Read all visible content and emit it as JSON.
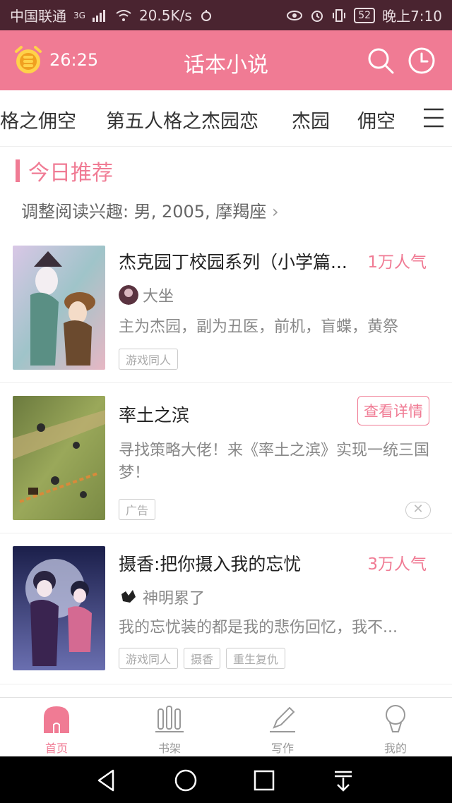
{
  "status_bar": {
    "carrier": "中国联通",
    "network": "3G",
    "speed": "20.5K/s",
    "battery": "52",
    "time": "晚上7:10"
  },
  "header": {
    "timer": "26:25",
    "title": "话本小说"
  },
  "tabs": [
    "格之佣空",
    "第五人格之杰园恋",
    "杰园",
    "佣空"
  ],
  "section": {
    "title": "今日推荐",
    "preference": "调整阅读兴趣: 男, 2005, 摩羯座"
  },
  "books": [
    {
      "title": "杰克园丁校园系列（小学篇...",
      "popularity": "1万人气",
      "author": "大坐",
      "description": "主为杰园，副为丑医，前机，盲蝶，黄祭",
      "tags": [
        "游戏同人"
      ]
    },
    {
      "title": "摄香:把你摄入我的忘忧",
      "popularity": "3万人气",
      "author": "神明累了",
      "description": "我的忘忧装的都是我的悲伤回忆，我不...",
      "tags": [
        "游戏同人",
        "摄香",
        "重生复仇"
      ]
    }
  ],
  "ad": {
    "title": "率土之滨",
    "button": "查看详情",
    "description": "寻找策略大佬！来《率土之滨》实现一统三国梦！",
    "tag": "广告",
    "close": "✕"
  },
  "bottom_nav": [
    {
      "label": "首页",
      "icon": "home-icon",
      "active": true
    },
    {
      "label": "书架",
      "icon": "bookshelf-icon",
      "active": false
    },
    {
      "label": "写作",
      "icon": "pencil-icon",
      "active": false
    },
    {
      "label": "我的",
      "icon": "profile-icon",
      "active": false
    }
  ],
  "colors": {
    "accent": "#f07b94",
    "status_bar": "#4a2430"
  }
}
